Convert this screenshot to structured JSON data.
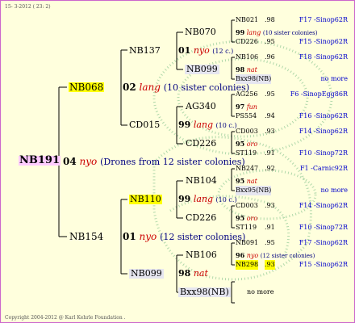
{
  "header": {
    "date": "15- 3-2012 ( 23: 2)"
  },
  "root": {
    "id": "NB191"
  },
  "gen1": {
    "code": "04",
    "race": "nyo",
    "note": "(Drones from 12 sister colonies)"
  },
  "sire_branch": {
    "id": "NB068",
    "code": "02",
    "race": "lang",
    "note": "(10 sister colonies)",
    "top": {
      "id": "NB137",
      "code": "01",
      "race": "nyo",
      "note": "(12 c.)",
      "queen": {
        "id": "NB070",
        "code": "99",
        "race": "lang",
        "note": "(10 sister colonies)"
      },
      "drone": {
        "id": "NB099",
        "code": "98",
        "race": "nat"
      }
    },
    "bottom": {
      "id": "CD015",
      "code": "99",
      "race": "lang",
      "note": "(10 c.)",
      "queen": {
        "id": "AG340",
        "code": "97",
        "race": "fun"
      },
      "drone": {
        "id": "CD226",
        "code": "95",
        "race": "oro"
      }
    }
  },
  "dam_branch": {
    "id": "NB154",
    "code": "01",
    "race": "nyo",
    "note": "(12 sister colonies)",
    "top": {
      "id": "NB110",
      "code": "99",
      "race": "lang",
      "note": "(10 c.)",
      "queen": {
        "id": "NB104",
        "code": "95",
        "race": "nat"
      },
      "drone": {
        "id": "CD226",
        "code": "95",
        "race": "oro"
      }
    },
    "bottom": {
      "id": "NB099",
      "code": "98",
      "race": "nat",
      "queen": {
        "id": "NB106",
        "code": "96",
        "race": "nyo",
        "note": "(12 sister colonies)"
      },
      "drone": {
        "id": "Bxx98(NB)"
      }
    }
  },
  "leaves": [
    {
      "id": "NB021",
      "score": ".98",
      "pedigree": "F17 -Sinop62R"
    },
    {
      "id": "CD226",
      "score": ".95",
      "pedigree": "F15 -Sinop62R"
    },
    {
      "id": "NB106",
      "score": ".96",
      "pedigree": "F18 -Sinop62R"
    },
    {
      "id": "Bxx98(NB)",
      "score": ".",
      "pedigree": "no more"
    },
    {
      "id": "AG256",
      "score": ".95",
      "pedigree": "F6 -SinopEgg86R"
    },
    {
      "id": "PS554",
      "score": ".94",
      "pedigree": "F16 -Sinop62R"
    },
    {
      "id": "CD003",
      "score": ".93",
      "pedigree": "F14 -Sinop62R"
    },
    {
      "id": "ST119",
      "score": ".91",
      "pedigree": "F10 -Sinop72R"
    },
    {
      "id": "NB247",
      "score": ".92",
      "pedigree": "F1 -Carnic92R"
    },
    {
      "id": "Bxx95(NB)",
      "score": ".",
      "pedigree": "no more"
    },
    {
      "id": "CD003",
      "score": ".93",
      "pedigree": "F14 -Sinop62R"
    },
    {
      "id": "ST119",
      "score": ".91",
      "pedigree": "F10 -Sinop72R"
    },
    {
      "id": "NB091",
      "score": ".95",
      "pedigree": "F17 -Sinop62R"
    },
    {
      "id": "NB298",
      "score": ".93",
      "pedigree": "F15 -Sinop62R"
    },
    {
      "id": "",
      "score": "",
      "pedigree": "no more"
    }
  ],
  "footer": {
    "copyright": "Copyright 2004-2012 @ Karl Kehrle Foundation ."
  }
}
